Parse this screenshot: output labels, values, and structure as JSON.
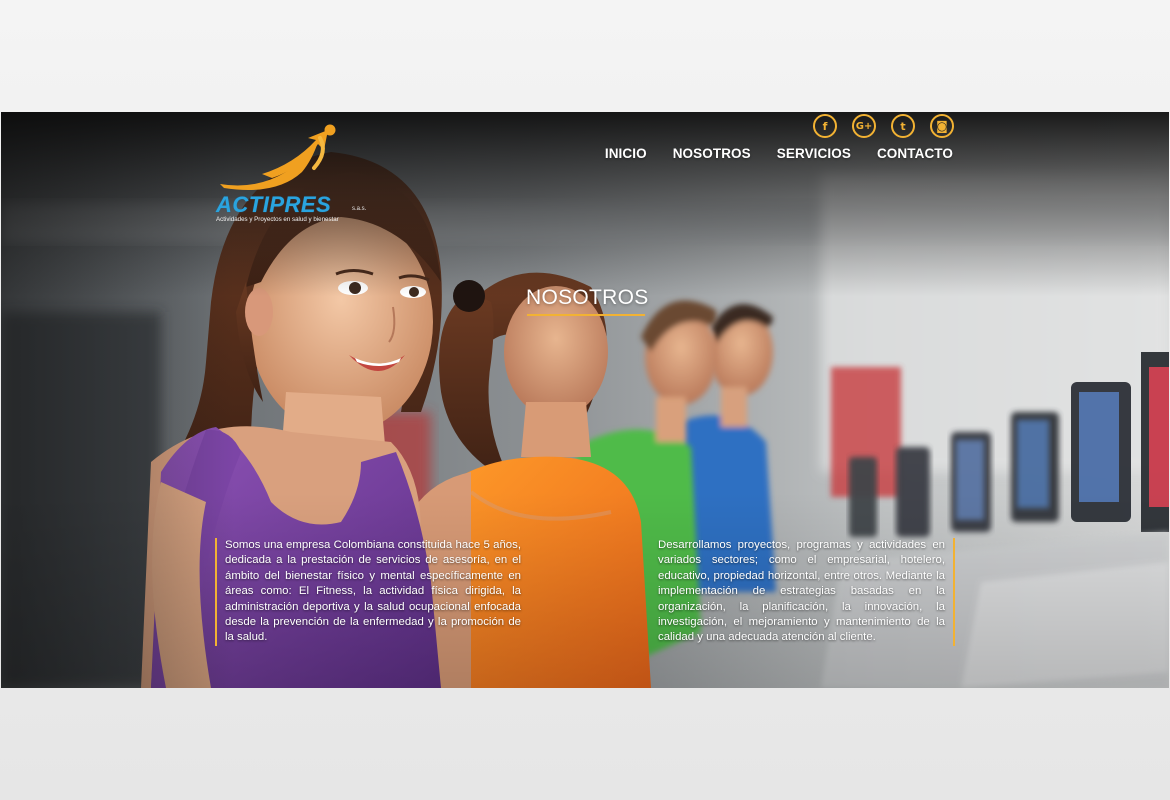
{
  "brand": {
    "name": "ACTIPRES",
    "suffix": "s.a.s.",
    "tagline": "Actividades y Proyectos en salud y bienestar"
  },
  "social": [
    {
      "icon": "facebook-icon",
      "glyph": "f"
    },
    {
      "icon": "google-plus-icon",
      "glyph": "G+"
    },
    {
      "icon": "twitter-icon",
      "glyph": "t"
    },
    {
      "icon": "instagram-icon",
      "glyph": "◙"
    }
  ],
  "nav": {
    "items": [
      "INICIO",
      "NOSOTROS",
      "SERVICIOS",
      "CONTACTO"
    ]
  },
  "hero": {
    "title": "NOSOTROS",
    "left_text": "Somos una empresa Colombiana constituida hace 5 años, dedicada a la prestación de servicios de asesoría, en el ámbito del bienestar físico y mental específicamente en áreas como: El Fitness, la actividad física dirigida, la administración deportiva y la salud ocupacional enfocada desde la prevención de la enfermedad y la promoción de la salud.",
    "right_text": "Desarrollamos proyectos, programas y actividades en variados sectores; como el empresarial, hotelero, educativo, propiedad horizontal, entre otros. Mediante la implementación de estrategias basadas en la organización, la planificación, la innovación, la investigación, el mejoramiento y mantenimiento de la calidad y una adecuada atención al cliente."
  },
  "colors": {
    "accent": "#f2b233",
    "logo_blue": "#2aa4df",
    "logo_orange": "#f0a020"
  }
}
